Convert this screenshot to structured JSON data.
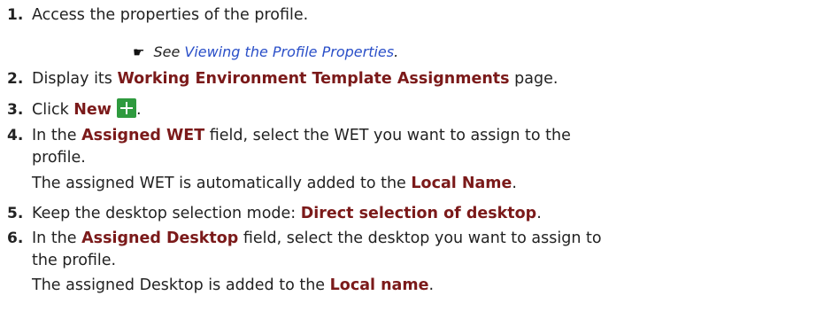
{
  "steps": [
    {
      "num": "1.",
      "text": "Access the properties of the profile."
    },
    {
      "num": "2.",
      "pre": "Display its ",
      "ui": "Working Environment Template Assignments",
      "post": " page."
    },
    {
      "num": "3.",
      "pre": "Click ",
      "ui": "New",
      "post": "."
    },
    {
      "num": "4.",
      "pre": "In the ",
      "ui": "Assigned WET",
      "post": " field, select the WET you want to assign to the",
      "cont1": "profile.",
      "cont2_pre": "The assigned WET is automatically added to the ",
      "cont2_ui": "Local Name",
      "cont2_post": "."
    },
    {
      "num": "5.",
      "pre": "Keep the desktop selection mode: ",
      "ui": "Direct selection of desktop",
      "post": "."
    },
    {
      "num": "6.",
      "pre": "In the ",
      "ui": "Assigned Desktop",
      "post": " field, select the desktop you want to assign to",
      "cont1": "the profile.",
      "cont2_pre": "The assigned Desktop is added to the ",
      "cont2_ui": "Local name",
      "cont2_post": "."
    }
  ],
  "see_also": {
    "prefix": "See ",
    "link": "Viewing the Profile Properties",
    "suffix": "."
  },
  "icons": {
    "pointing_hand": "☛",
    "new_button": "plus-icon"
  },
  "colors": {
    "ui_term": "#7b1a1a",
    "link": "#2a4fc8",
    "new_button": "#2e9a3e"
  }
}
